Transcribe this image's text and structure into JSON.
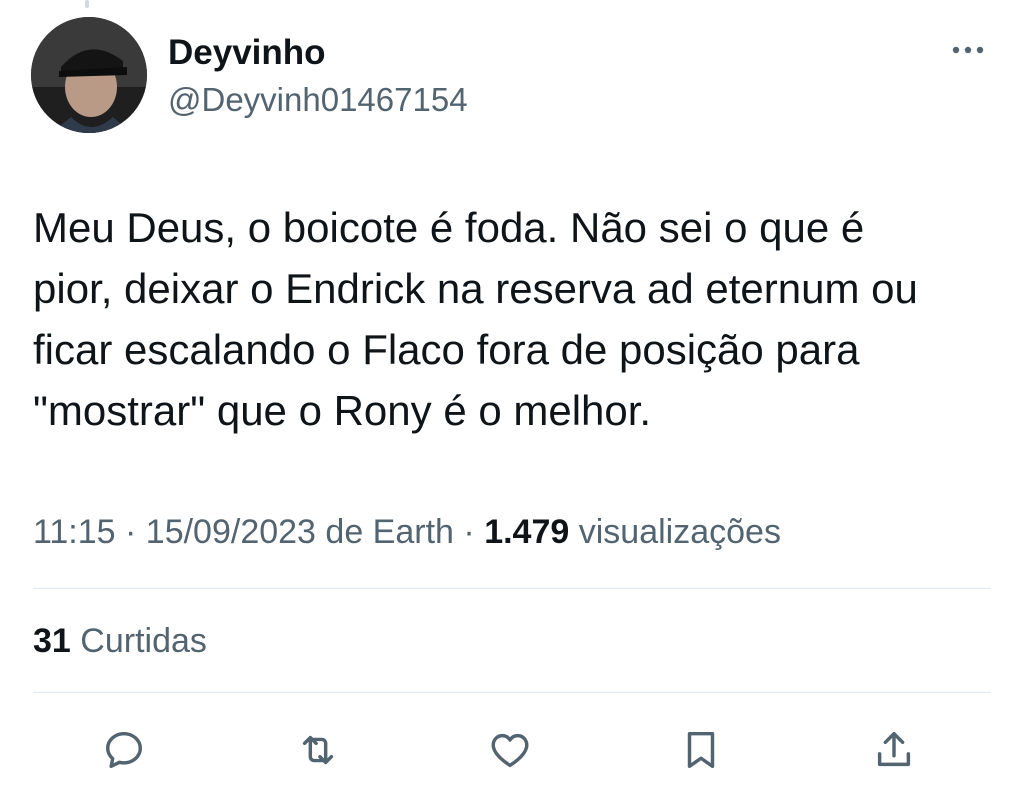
{
  "user": {
    "display_name": "Deyvinho",
    "handle": "@Deyvinh01467154"
  },
  "tweet": {
    "text": "Meu Deus, o boicote é foda. Não sei o que é\npior, deixar o Endrick na reserva ad eternum ou\nficar escalando o Flaco fora de posição para\n\"mostrar\" que o Rony é o melhor.",
    "time": "11:15",
    "separator": "·",
    "date": "15/09/2023",
    "source": "de Earth",
    "views_count": "1.479",
    "views_label": "visualizações",
    "likes_count": "31",
    "likes_label": "Curtidas"
  },
  "icons": {
    "more": "more-horizontal-icon",
    "reply": "reply-bubble-icon",
    "retweet": "retweet-icon",
    "like": "heart-icon",
    "bookmark": "bookmark-icon",
    "share": "share-icon"
  },
  "colors": {
    "text_primary": "#0f1419",
    "text_secondary": "#536471",
    "divider": "#e1e8ed"
  }
}
